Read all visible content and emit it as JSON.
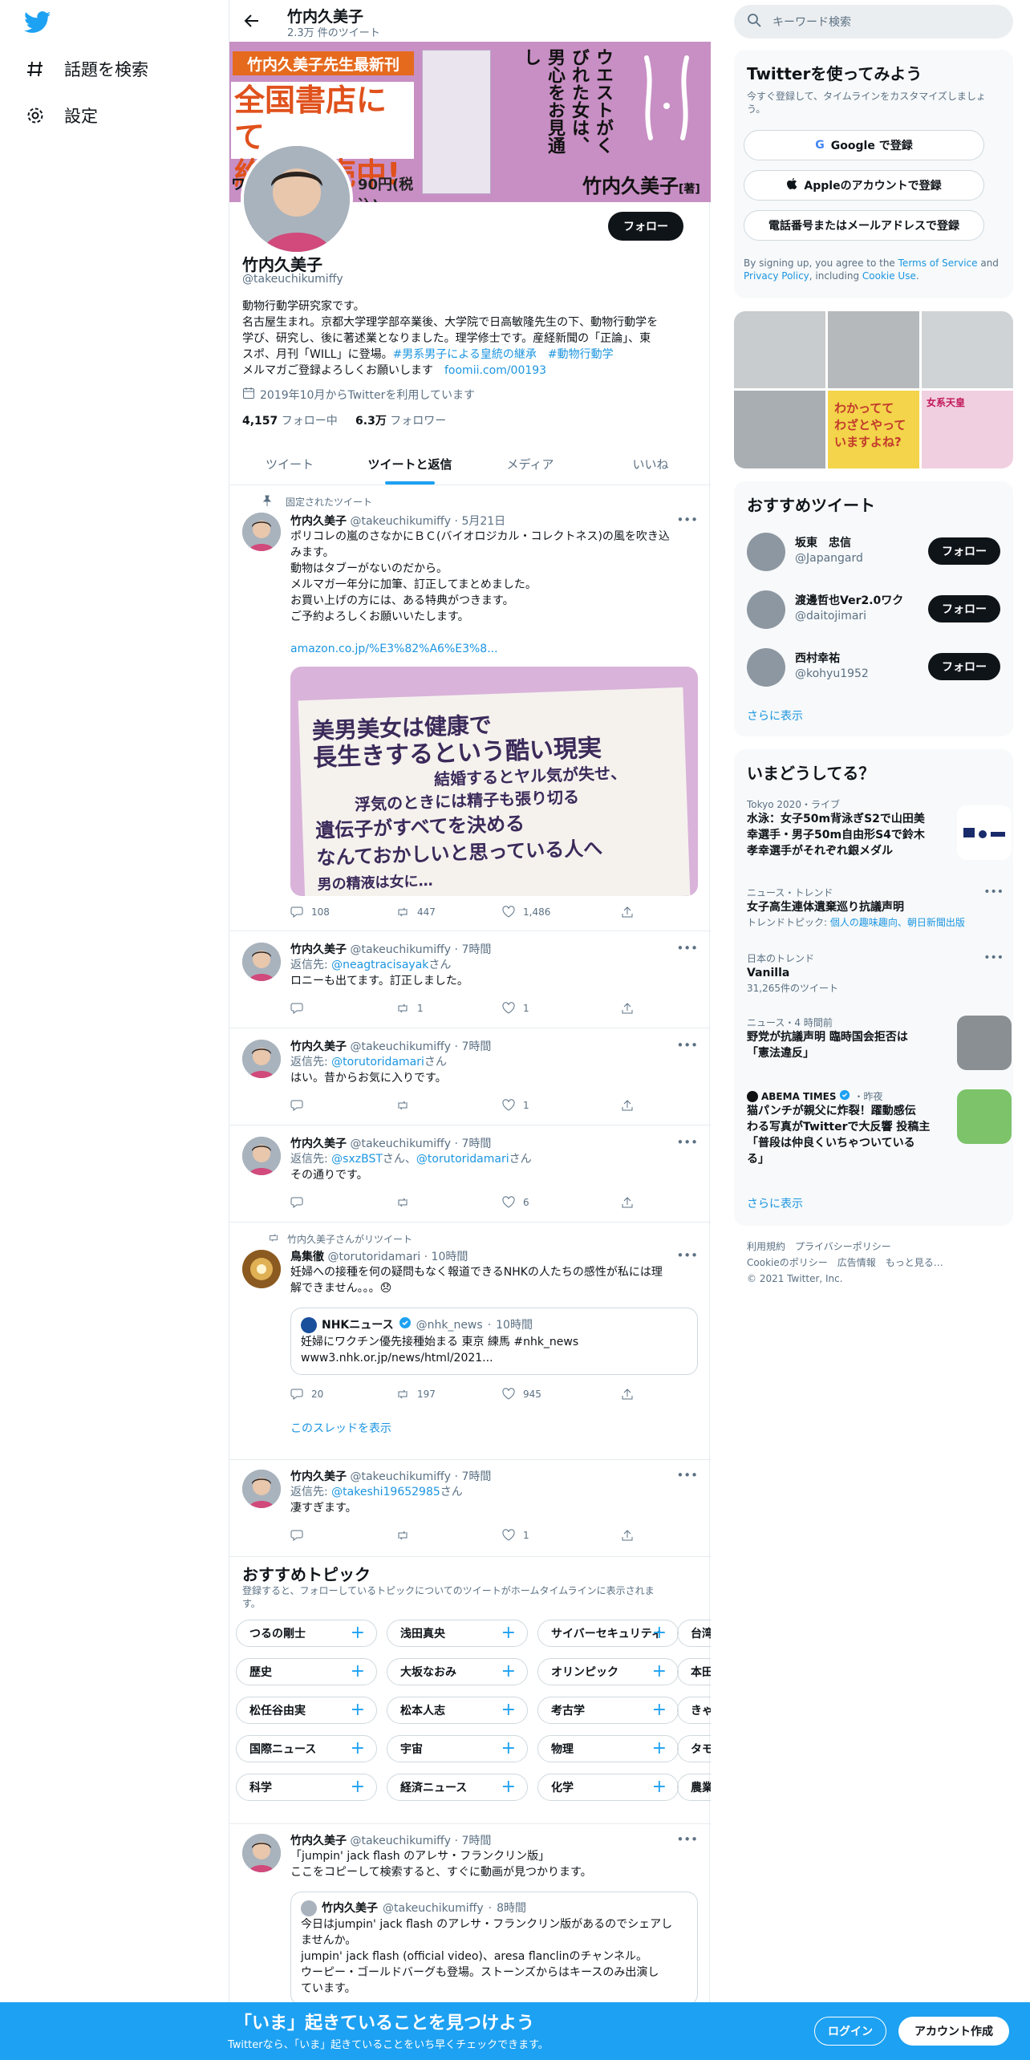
{
  "nav": {
    "explore": "話題を検索",
    "settings": "設定"
  },
  "header": {
    "name": "竹内久美子",
    "tweet_count": "2.3万 件のツイート"
  },
  "banner": {
    "tag": "竹内久美子先生最新刊",
    "headline_1": "全国書店にて",
    "headline_2": "絶賛発売中!",
    "price": "90円(税込)",
    "price_prefix": "ワ",
    "book_title_1": "ウエストが",
    "book_title_2": "くびれた女は、",
    "book_title_3": "男心をお見通し",
    "author": "竹内久美子",
    "author_suffix": "[著]"
  },
  "profile": {
    "name": "竹内久美子",
    "handle": "@takeuchikumiffy",
    "follow_label": "フォロー",
    "bio_1": "動物行動学研究家です。",
    "bio_2": "名古屋生まれ。京都大学理学部卒業後、大学院で日高敏隆先生の下、動物行動学を",
    "bio_3": "学び、研究し、後に著述業となりました。理学修士です。産経新聞の「正論」、東",
    "bio_4": "スポ、月刊「WILL」に登場。",
    "bio_hashtag_1": "#男系男子による皇統の継承",
    "bio_hashtag_2": "#動物行動学",
    "bio_5": "メルマガご登録よろしくお願いします",
    "bio_link": "foomii.com/00193",
    "joined": "2019年10月からTwitterを利用しています",
    "following_count": "4,157",
    "following_label": "フォロー中",
    "followers_count": "6.3万",
    "followers_label": "フォロワー"
  },
  "tabs": [
    "ツイート",
    "ツイートと返信",
    "メディア",
    "いいね"
  ],
  "tweets": {
    "pinned_label": "固定されたツイート",
    "t1": {
      "name": "竹内久美子",
      "handle": "@takeuchikumiffy",
      "time": "5月21日",
      "l1": "ポリコレの嵐のさなかにＢＣ(バイオロジカル・コレクトネス)の風を吹き込",
      "l2": "みます。",
      "l3": "動物はタブーがないのだから。",
      "l4": "メルマガ一年分に加筆、訂正してまとめました。",
      "l5": "お買い上げの方には、ある特典がつきます。",
      "l6": "ご予約よろしくお願いいたします。",
      "link": "amazon.co.jp/%E3%82%A6%E3%8...",
      "img_1": "美男美女は健康で",
      "img_2": "長生きするという酷い現実",
      "img_3": "結婚するとヤル気が失せ、",
      "img_4": "浮気のときには精子も張り切る",
      "img_5": "遺伝子がすべてを決める",
      "img_6": "なんておかしいと思っている人へ",
      "img_7": "男の精液は女に…",
      "replies": "108",
      "retweets": "447",
      "likes": "1,486"
    },
    "t2": {
      "name": "竹内久美子",
      "handle": "@takeuchikumiffy",
      "time": "7時間",
      "reply_prefix": "返信先: ",
      "reply_to": "@neagtracisayak",
      "reply_suffix": "さん",
      "text": "ロニーも出てます。訂正しました。",
      "retweets": "1",
      "likes": "1"
    },
    "t3": {
      "name": "竹内久美子",
      "handle": "@takeuchikumiffy",
      "time": "7時間",
      "reply_prefix": "返信先: ",
      "reply_to": "@torutoridamari",
      "reply_suffix": "さん",
      "text": "はい。昔からお気に入りです。",
      "likes": "1"
    },
    "t4": {
      "name": "竹内久美子",
      "handle": "@takeuchikumiffy",
      "time": "7時間",
      "reply_prefix": "返信先: ",
      "reply_to": "@sxzBST",
      "reply_mid": "さん、",
      "reply_to_2": "@torutoridamari",
      "reply_suffix": "さん",
      "text": "その通りです。",
      "likes": "6"
    },
    "t5": {
      "retweet_label": "竹内久美子さんがリツイート",
      "name": "鳥集徹",
      "handle": "@torutoridamari",
      "time": "10時間",
      "l1": "妊婦への接種を何の疑問もなく報道できるNHKの人たちの感性が私には理",
      "l2": "解できません。。。😞",
      "q_name": "NHKニュース",
      "q_handle": "@nhk_news",
      "q_time": "10時間",
      "q_text": "妊婦にワクチン優先接種始まる 東京 練馬 #nhk_news",
      "q_link": "www3.nhk.or.jp/news/html/2021...",
      "replies": "20",
      "retweets": "197",
      "likes": "945",
      "thread": "このスレッドを表示"
    },
    "t6": {
      "name": "竹内久美子",
      "handle": "@takeuchikumiffy",
      "time": "7時間",
      "reply_prefix": "返信先: ",
      "reply_to": "@takeshi19652985",
      "reply_suffix": "さん",
      "text": "凄すぎます。",
      "likes": "1"
    },
    "t7": {
      "name": "竹内久美子",
      "handle": "@takeuchikumiffy",
      "time": "7時間",
      "l1": "「jumpin' jack flash のアレサ・フランクリン版」",
      "l2": "ここをコピーして検索すると、すぐに動画が見つかります。",
      "q_name": "竹内久美子",
      "q_handle": "@takeuchikumiffy",
      "q_time": "8時間",
      "q_l1": "今日はjumpin' jack flash のアレサ・フランクリン版があるのでシェアし",
      "q_l2": "ませんか。",
      "q_l3": "jumpin' jack flash (official video)、aresa flanclinのチャンネル。",
      "q_l4": "ウーピー・ゴールドバーグも登場。ストーンズからはキースのみ出演し",
      "q_l5": "ています。"
    }
  },
  "topics": {
    "title": "おすすめトピック",
    "desc_1": "登録すると、フォローしているトピックについてのツイートがホームタイムラインに表示されま",
    "desc_2": "す。",
    "rows": [
      [
        "つるの剛士",
        "浅田真央",
        "サイバーセキュリティ",
        "台湾"
      ],
      [
        "歴史",
        "大坂なおみ",
        "オリンピック",
        "本田"
      ],
      [
        "松任谷由実",
        "松本人志",
        "考古学",
        "きゃ"
      ],
      [
        "国際ニュース",
        "宇宙",
        "物理",
        "タモ"
      ],
      [
        "科学",
        "経済ニュース",
        "化学",
        "農業"
      ]
    ]
  },
  "right": {
    "search_placeholder": "キーワード検索",
    "signup": {
      "title": "Twitterを使ってみよう",
      "sub": "今すぐ登録して、タイムラインをカスタマイズしましょう。",
      "google": "Google で登録",
      "apple": "Appleのアカウントで登録",
      "phone": "電話番号またはメールアドレスで登録",
      "terms_1": "By signing up, you agree to the ",
      "terms_link1": "Terms of Service",
      "terms_2": " and",
      "terms_link2": "Privacy Policy",
      "terms_3": ", including ",
      "terms_link3": "Cookie Use",
      "terms_4": "."
    },
    "media_labels": [
      "わかってて",
      "わざとやって",
      "いますよね?",
      "女系天皇"
    ],
    "who_to_follow": {
      "title": "おすすめツイート",
      "users": [
        {
          "name": "坂東　忠信",
          "handle": "@Japangard"
        },
        {
          "name": "渡邊哲也Ver2.0ワク",
          "handle": "@daitojimari"
        },
        {
          "name": "西村幸祐",
          "handle": "@kohyu1952"
        }
      ],
      "follow": "フォロー",
      "more": "さらに表示"
    },
    "trends": {
      "title": "いまどうしてる？",
      "items": [
        {
          "meta": "Tokyo 2020・ライブ",
          "l1": "水泳：女子50m背泳ぎS2で山田美",
          "l2": "幸選手・男子50m自由形S4で鈴木",
          "l3": "孝幸選手がそれぞれ銀メダル"
        },
        {
          "meta": "ニュース・トレンド",
          "l1": "女子高生連体遺棄巡り抗議声明",
          "sub_prefix": "トレンドトピック: ",
          "sub": "個人の趣味趣向、朝日新聞出版"
        },
        {
          "meta": "日本のトレンド",
          "l1": "Vanilla",
          "count": "31,265件のツイート"
        },
        {
          "meta": "ニュース・4 時間前",
          "l1": "野党が抗議声明 臨時国会拒否は",
          "l2": "「憲法違反」"
        },
        {
          "source": "ABEMA TIMES",
          "time": "・昨夜",
          "l1": "猫パンチが親父に炸裂！躍動感伝",
          "l2": "わる写真がTwitterで大反響 投稿主",
          "l3": "「普段は仲良くいちゃついている",
          "l4": "る」"
        }
      ],
      "more": "さらに表示"
    },
    "footer": {
      "l1": "利用規約　プライバシーポリシー",
      "l2": "Cookieのポリシー　広告情報　もっと見る…",
      "l3": "© 2021 Twitter, Inc."
    }
  },
  "bottombar": {
    "title": "「いま」起きていることを見つけよう",
    "sub": "Twitterなら、「いま」起きていることをいち早くチェックできます。",
    "login": "ログイン",
    "signup": "アカウント作成"
  },
  "colors": {
    "accent": "#1da1f2",
    "link": "#1b95e0",
    "banner_pink": "#c88fc4",
    "banner_orange": "#e56a1e"
  }
}
